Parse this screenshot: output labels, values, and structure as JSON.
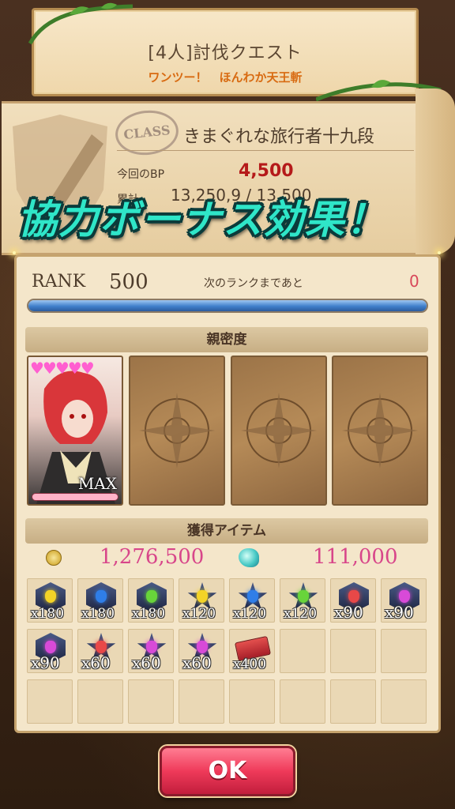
{
  "quest": {
    "title": "[4人]討伐クエスト",
    "subtitle": "ワンツー！　ほんわか天王斬"
  },
  "class": {
    "badge": "CLASS",
    "name": "きまぐれな旅行者十九段",
    "bp_label": "今回のBP",
    "bp_value": "4,500",
    "total_label": "累計",
    "total_value": "13,250,9 / 13,500"
  },
  "bonus_banner": "協力ボーナス効果！",
  "rank": {
    "label": "RANK",
    "value": "500",
    "next_label": "次のランクまであと",
    "next_value": "0",
    "progress_fraction": 1.0
  },
  "affinity": {
    "title": "親密度",
    "card_hearts": "♥♥♥♥♥",
    "card_max": "MAX",
    "empty_slots": 3
  },
  "items": {
    "title": "獲得アイテム",
    "coins_icon": "coin-icon",
    "coins": "1,276,500",
    "spirit_icon": "spirit-icon",
    "spirit": "111,000",
    "list": [
      {
        "qty": "x180",
        "color": "#f3d327",
        "shape": "hex"
      },
      {
        "qty": "x180",
        "color": "#2f7ee8",
        "shape": "hex"
      },
      {
        "qty": "x180",
        "color": "#68d43a",
        "shape": "hex"
      },
      {
        "qty": "x120",
        "color": "#f3d327",
        "shape": "star"
      },
      {
        "qty": "x120",
        "color": "#2f7ee8",
        "shape": "star"
      },
      {
        "qty": "x120",
        "color": "#68d43a",
        "shape": "star"
      },
      {
        "qty": "x90",
        "color": "#e84848",
        "shape": "hex"
      },
      {
        "qty": "x90",
        "color": "#d84ad8",
        "shape": "hex"
      },
      {
        "qty": "x90",
        "color": "#d84ad8",
        "shape": "hex"
      },
      {
        "qty": "x60",
        "color": "#e84848",
        "shape": "star"
      },
      {
        "qty": "x60",
        "color": "#d84ad8",
        "shape": "star"
      },
      {
        "qty": "x60",
        "color": "#d84ad8",
        "shape": "star"
      },
      {
        "qty": "x400",
        "color": "#e4504e",
        "shape": "ticket"
      }
    ],
    "total_slots": 24
  },
  "ok_button": "OK"
}
